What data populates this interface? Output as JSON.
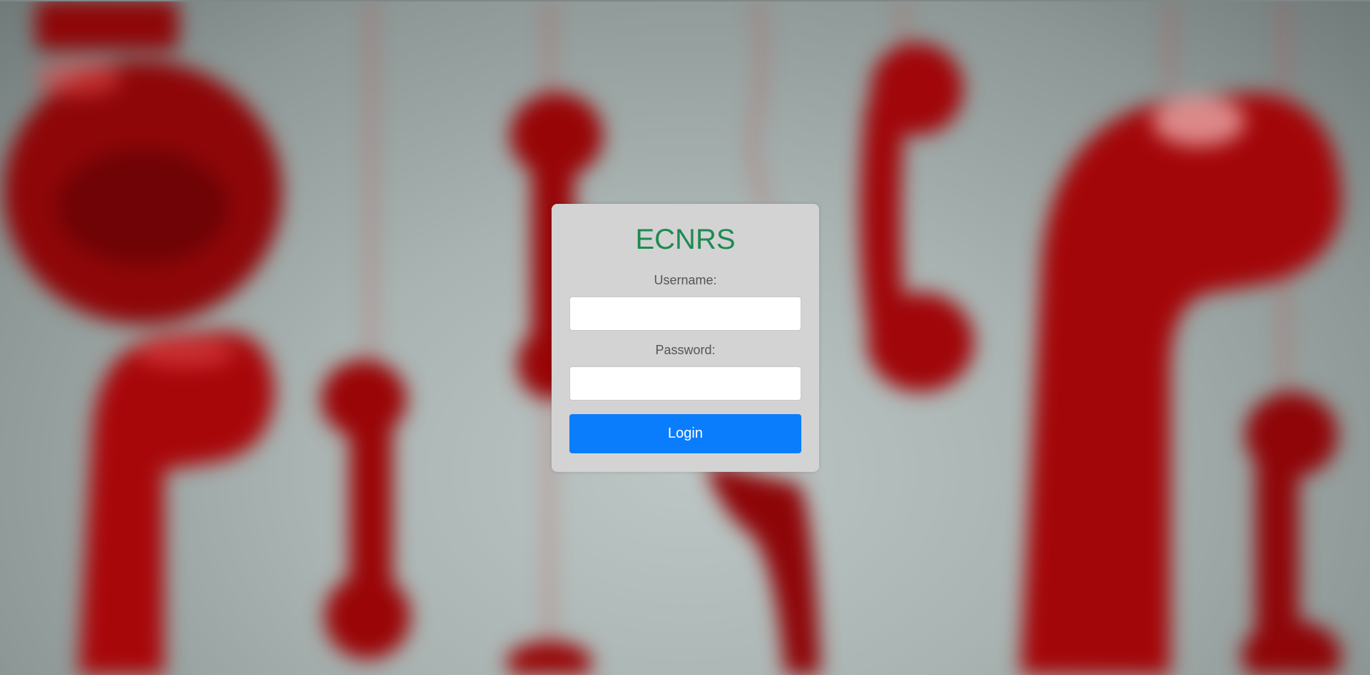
{
  "background": {
    "description_icon": "red-telephone-handsets-icon",
    "accent_color": "#b00000"
  },
  "login": {
    "title": "ECNRS",
    "title_color": "#1e8a52",
    "username_label": "Username:",
    "username_value": "",
    "password_label": "Password:",
    "password_value": "",
    "button_label": "Login",
    "button_color": "#0a7dfc"
  }
}
